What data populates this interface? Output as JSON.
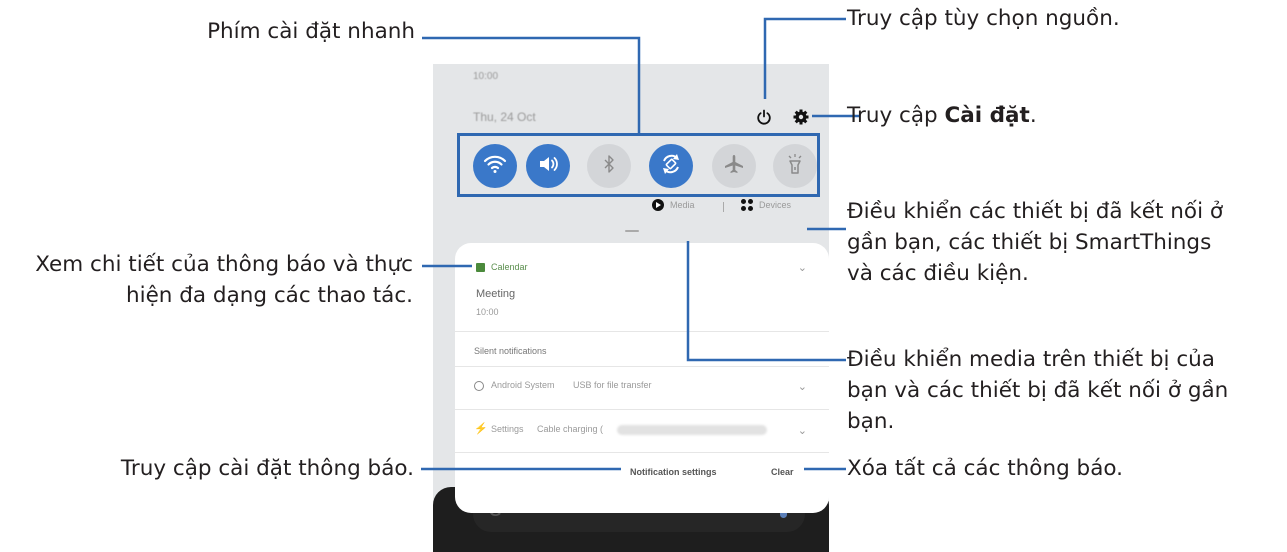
{
  "callouts": {
    "quick_settings": "Phím cài đặt nhanh",
    "power_options": "Truy cập tùy chọn nguồn.",
    "settings_prefix": "Truy cập ",
    "settings_bold": "Cài đặt",
    "settings_suffix": ".",
    "devices_lines": [
      "Điều khiển các thiết bị đã kết nối ở",
      "gần bạn, các thiết bị SmartThings",
      "và các điều kiện."
    ],
    "notif_detail_lines": [
      "Xem chi tiết của thông báo và thực",
      "hiện đa dạng các thao tác."
    ],
    "media_lines": [
      "Điều khiển media trên thiết bị của",
      "bạn và các thiết bị đã kết nối ở gần",
      "bạn."
    ],
    "notif_settings": "Truy cập cài đặt thông báo.",
    "clear_all": "Xóa tất cả các thông báo."
  },
  "phone": {
    "clock": "10:00",
    "date": "Thu, 24 Oct",
    "media_label": "Media",
    "devices_label": "Devices",
    "notification": {
      "app": "Calendar",
      "title": "Meeting",
      "time": "10:00"
    },
    "silent_header": "Silent notifications",
    "silent_items": [
      {
        "app": "Android System",
        "text": "USB for file transfer"
      },
      {
        "app": "Settings",
        "text": "Cable charging ("
      }
    ],
    "notification_settings_button": "Notification settings",
    "clear_button": "Clear"
  },
  "toggles": [
    {
      "name": "wifi",
      "on": true
    },
    {
      "name": "sound",
      "on": true
    },
    {
      "name": "bluetooth",
      "on": false
    },
    {
      "name": "auto-rotate",
      "on": true
    },
    {
      "name": "airplane",
      "on": false
    },
    {
      "name": "flashlight",
      "on": false
    }
  ],
  "colors": {
    "accent": "#3a78c9",
    "callout_line": "#2f68b1",
    "text": "#231f20"
  }
}
